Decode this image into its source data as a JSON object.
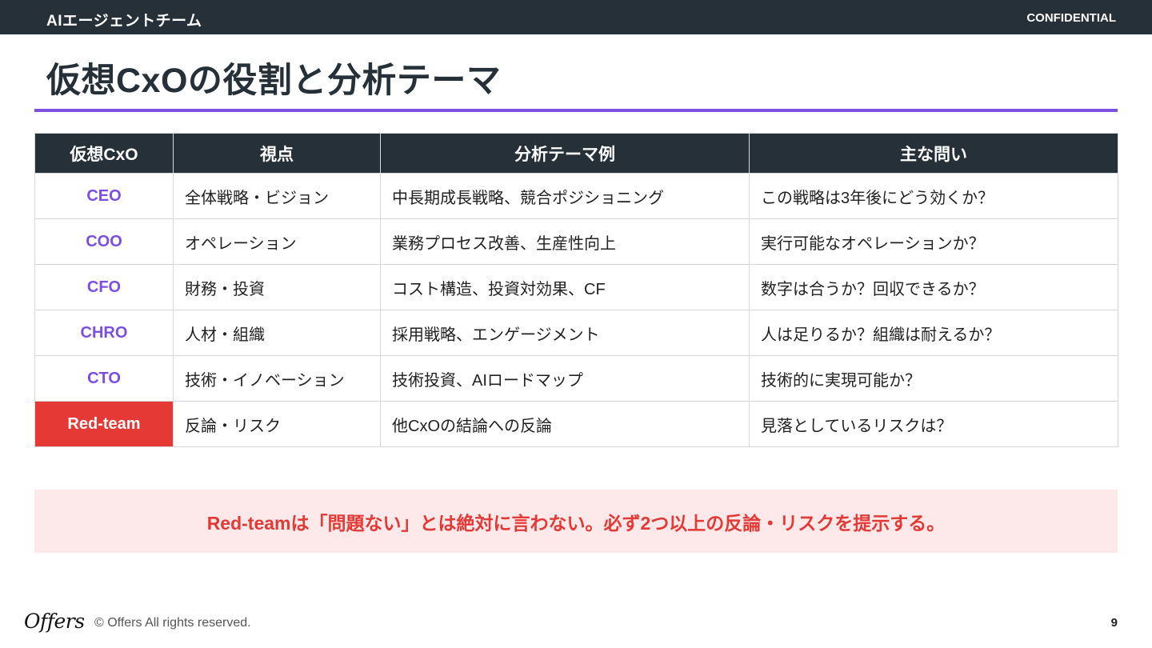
{
  "header": {
    "team": "AIエージェントチーム",
    "confidential": "CONFIDENTIAL"
  },
  "title": "仮想CxOの役割と分析テーマ",
  "table": {
    "headers": [
      "仮想CxO",
      "視点",
      "分析テーマ例",
      "主な問い"
    ],
    "rows": [
      [
        "CEO",
        "全体戦略・ビジョン",
        "中長期成長戦略、競合ポジショニング",
        "この戦略は3年後にどう効くか？"
      ],
      [
        "COO",
        "オペレーション",
        "業務プロセス改善、生産性向上",
        "実行可能なオペレーションか？"
      ],
      [
        "CFO",
        "財務・投資",
        "コスト構造、投資対効果、CF",
        "数字は合うか？回収できるか？"
      ],
      [
        "CHRO",
        "人材・組織",
        "採用戦略、エンゲージメント",
        "人は足りるか？組織は耐えるか？"
      ],
      [
        "CTO",
        "技術・イノベーション",
        "技術投資、AIロードマップ",
        "技術的に実現可能か？"
      ],
      [
        "Red-team",
        "反論・リスク",
        "他CxOの結論への反論",
        "見落としているリスクは？"
      ]
    ]
  },
  "callout": "Red-teamは「問題ない」とは絶対に言わない。必ず2つ以上の反論・リスクを提示する。",
  "footer": {
    "logo": "Offers",
    "copyright": "© Offers All rights reserved.",
    "page": "9"
  },
  "colors": {
    "dark": "#263038",
    "accent": "#7b4fe0",
    "red": "#e53935",
    "callout_bg": "#fde8ea"
  }
}
